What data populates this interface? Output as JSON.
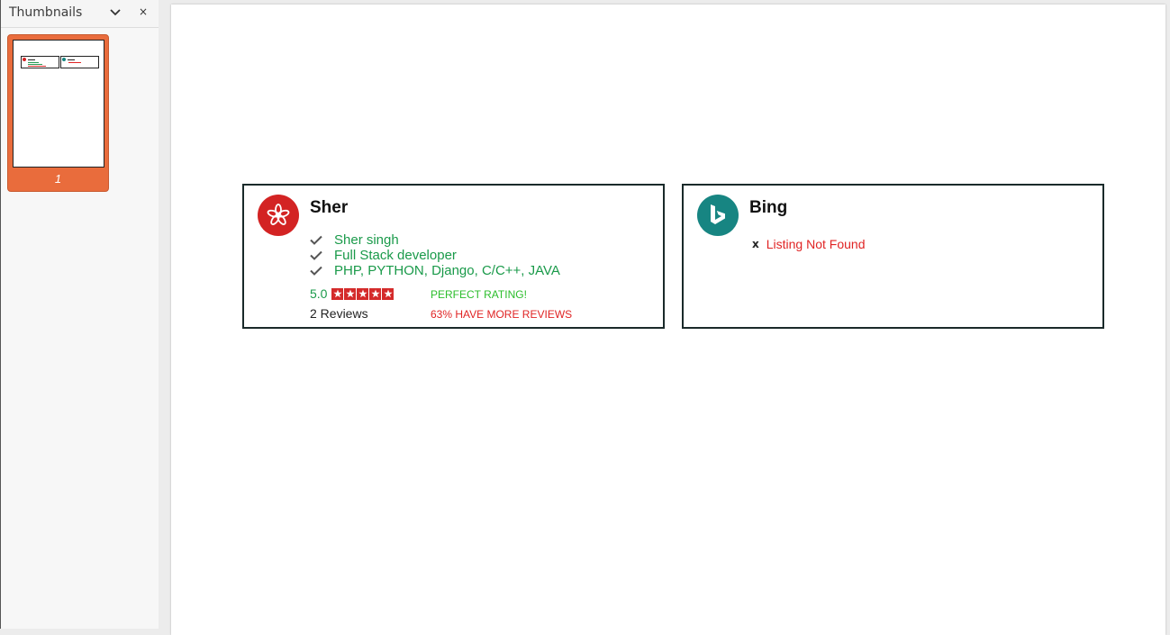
{
  "sidebar": {
    "title": "Thumbnails",
    "close_symbol": "×",
    "thumbnails": [
      {
        "page_label": "1",
        "selected": true
      }
    ]
  },
  "cards": [
    {
      "name": "Sher",
      "logo_icon": "yelp-icon",
      "logo_color": "#d32323",
      "items": [
        "Sher singh",
        "Full Stack developer",
        "PHP, PYTHON, Django, C/C++, JAVA"
      ],
      "rating": "5.0",
      "stars": 5,
      "reviews": "2 Reviews",
      "rating_note": "PERFECT RATING!",
      "reviews_note": "63% HAVE MORE REVIEWS"
    },
    {
      "name": "Bing",
      "logo_icon": "bing-icon",
      "logo_color": "#178582",
      "status_symbol": "x",
      "status_text": "Listing Not Found"
    }
  ],
  "colors": {
    "accent_orange": "#e96c3c",
    "success_green": "#1a9a4a",
    "error_red": "#e02424",
    "star_red": "#d42a2a"
  }
}
